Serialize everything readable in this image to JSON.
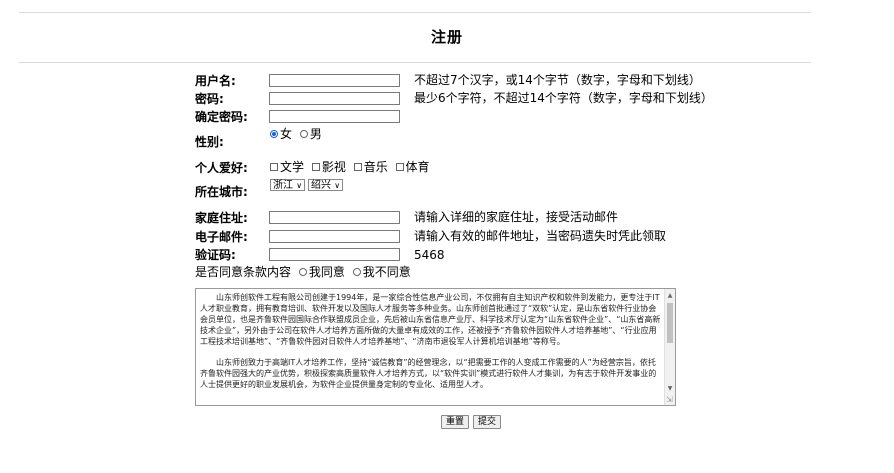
{
  "page": {
    "title": "注册"
  },
  "form": {
    "username": {
      "label": "用户名:",
      "hint": "不超过7个汉字，或14个字节（数字，字母和下划线）",
      "value": ""
    },
    "password": {
      "label": "密码:",
      "hint": "最少6个字符，不超过14个字符（数字，字母和下划线）",
      "value": ""
    },
    "confirm": {
      "label": "确定密码:",
      "value": ""
    },
    "gender": {
      "label": "性别:",
      "options": [
        "女",
        "男"
      ],
      "selected": "女"
    },
    "hobbies": {
      "label": "个人爱好:",
      "options": [
        "文学",
        "影视",
        "音乐",
        "体育"
      ]
    },
    "city": {
      "label": "所在城市:",
      "province": "浙江",
      "city": "绍兴"
    },
    "address": {
      "label": "家庭住址:",
      "hint": "请输入详细的家庭住址，接受活动邮件",
      "value": ""
    },
    "email": {
      "label": "电子邮件:",
      "hint": "请输入有效的邮件地址，当密码遗失时凭此领取",
      "value": ""
    },
    "captcha": {
      "label": "验证码:",
      "code": "5468",
      "value": ""
    },
    "agree": {
      "label": "是否同意条款内容",
      "options": [
        "我同意",
        "我不同意"
      ]
    },
    "terms": {
      "p1": "山东师创软件工程有限公司创建于1994年，是一家综合性信息产业公司，不仅拥有自主知识产权和软件到发能力，更专注于IT人才职业教育，拥有教育培训、软件开发以及国际人才服务等多种业务。山东师创首批通过了“双软”认定，是山东省软件行业协会会员单位，也是齐鲁软件园国际合作联盟成员企业，先后被山东省信息产业厅、科学技术厅认定为“山东省软件企业”、“山东省高新技术企业”，另外由于公司在软件人才培养方面所做的大量卓有成效的工作，还被授予“齐鲁软件园软件人才培养基地”、“行业应用工程技术培训基地”、“齐鲁软件园对日软件人才培养基地”、“济南市退役军人计算机培训基地”等称号。",
      "p2": "山东师创致力于高端IT人才培养工作，坚持“诚信教育”的经营理念，以“把需要工作的人变成工作需要的人”为经营宗旨，依托齐鲁软件园强大的产业优势，积极探索高质量软件人才培养方式，以“软件实训”模式进行软件人才集训，为有志于软件开发事业的人士提供更好的职业发展机会，为软件企业提供量身定制的专业化、适用型人才。"
    },
    "buttons": {
      "reset": "重置",
      "submit": "提交"
    }
  }
}
